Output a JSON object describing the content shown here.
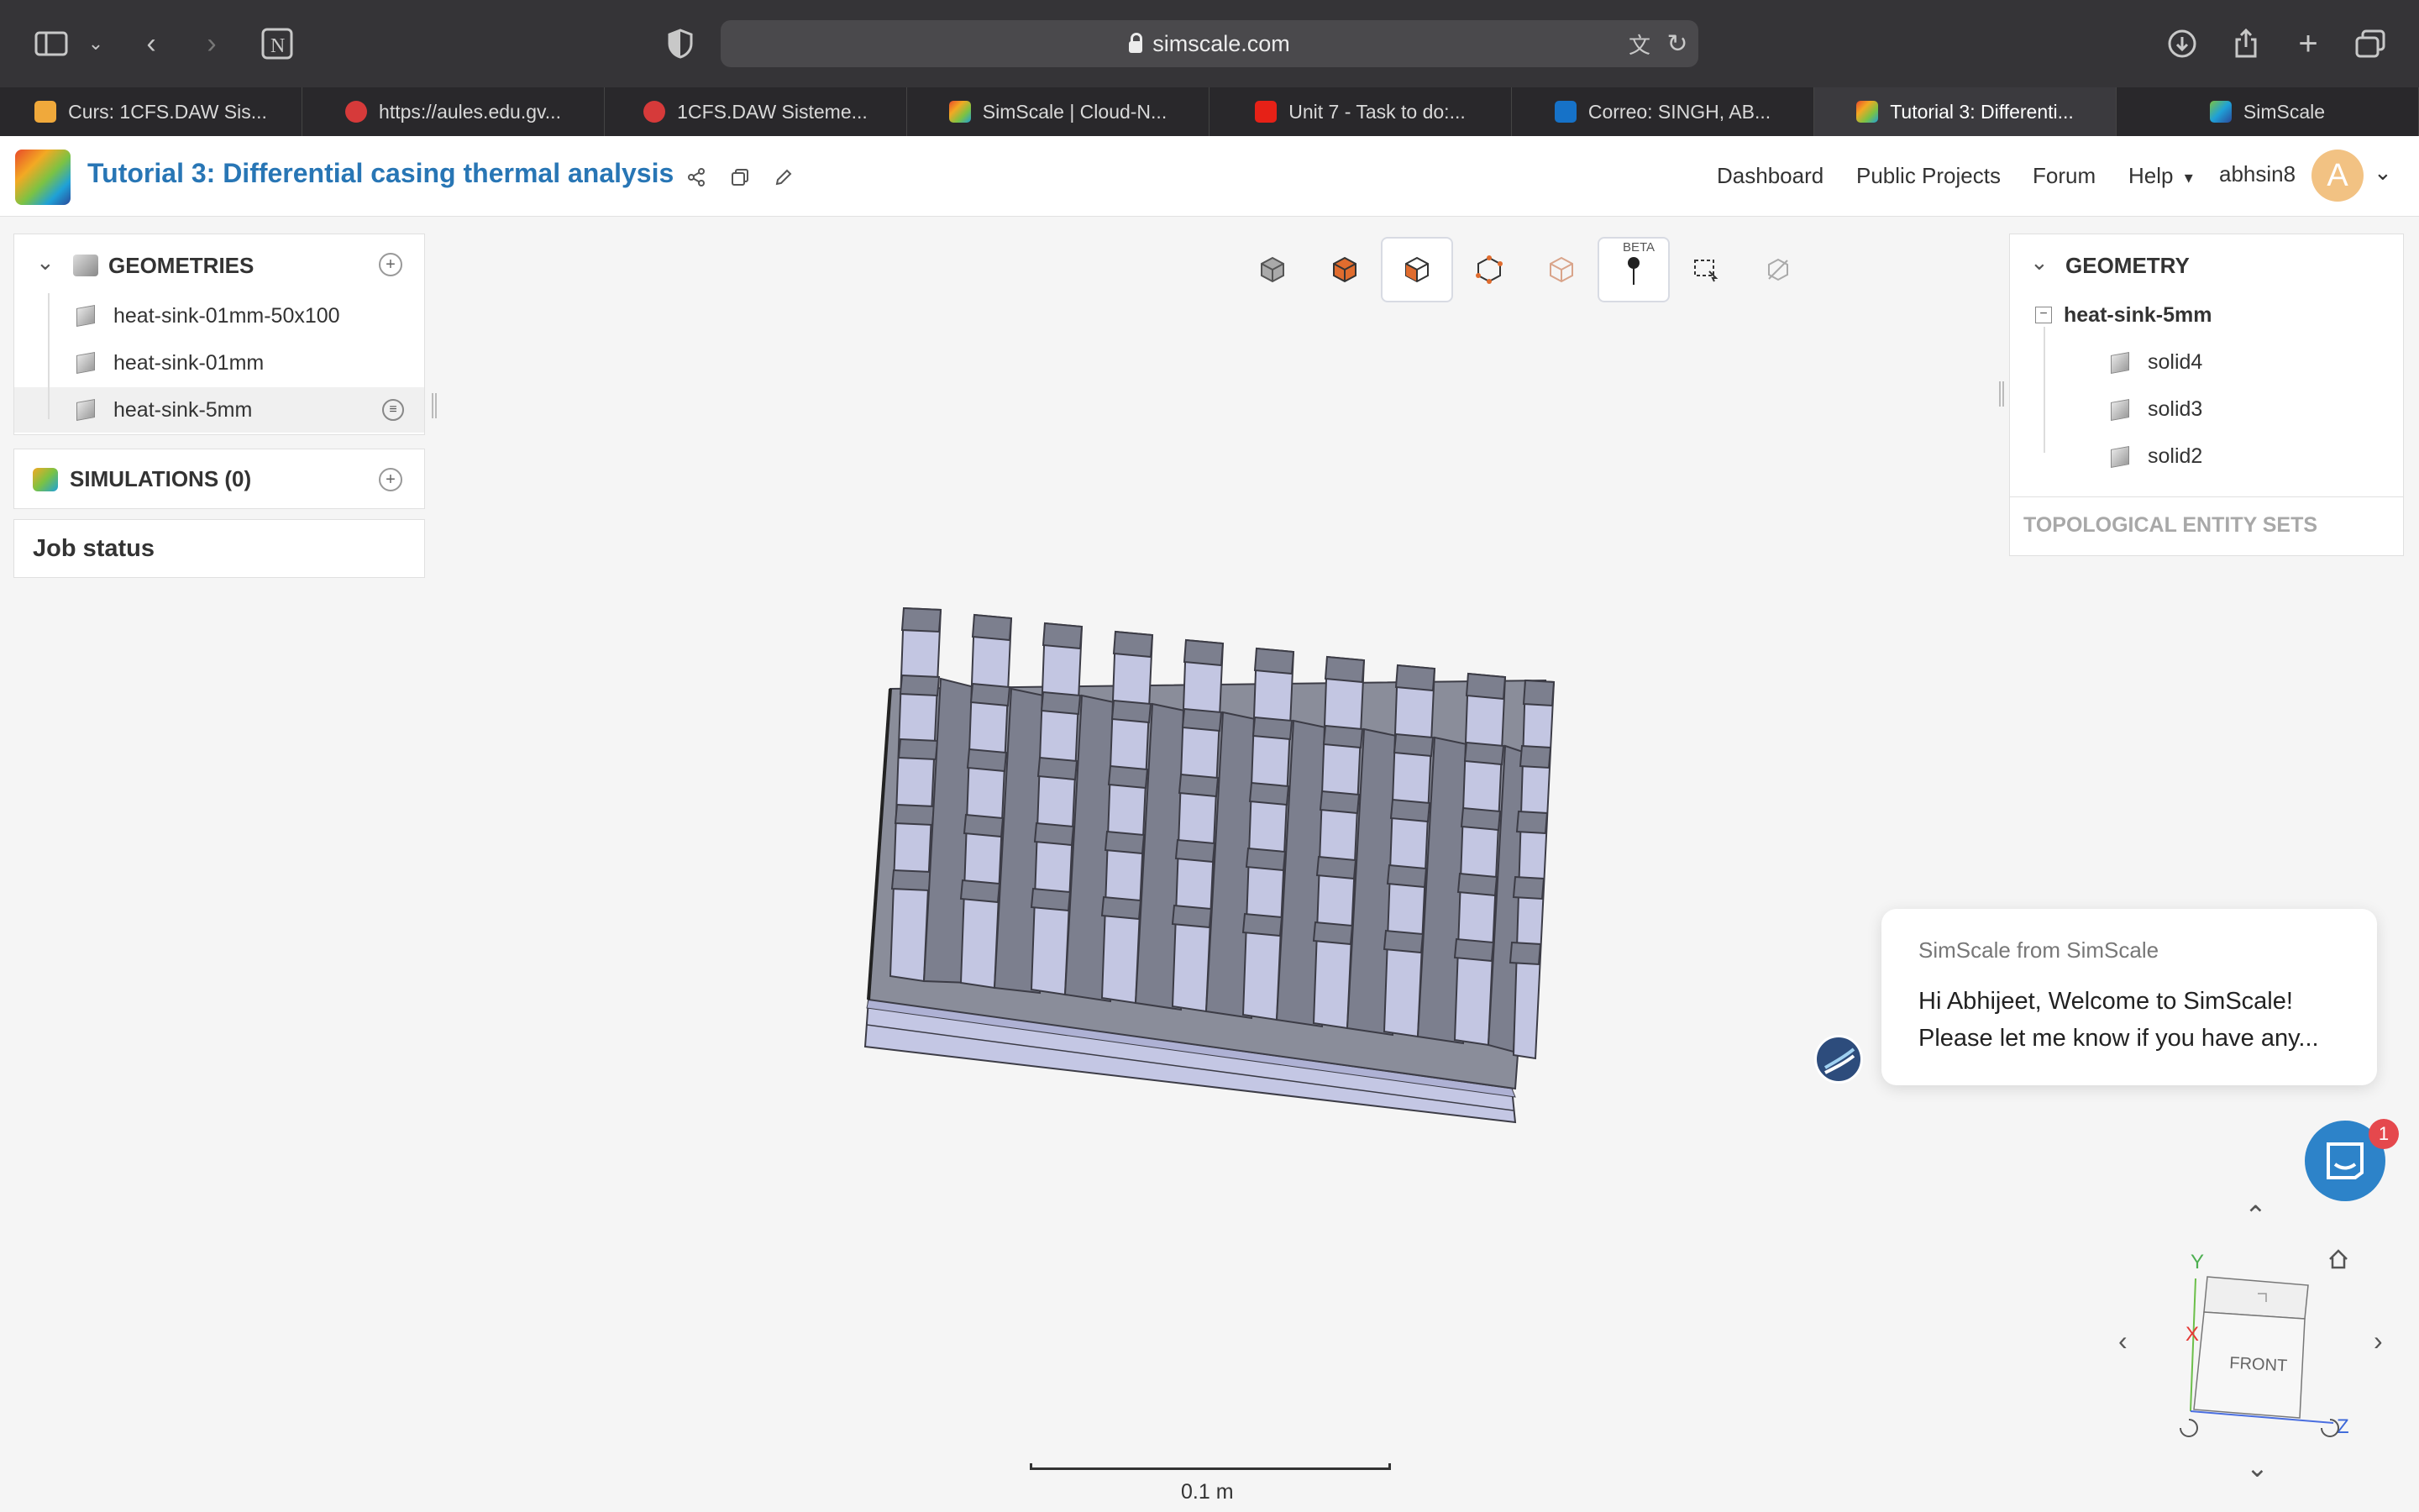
{
  "browser": {
    "url": "simscale.com",
    "tabs": [
      {
        "label": "Curs: 1CFS.DAW Sis...",
        "icon": "moodle-icon",
        "color": "#f0a93b"
      },
      {
        "label": "https://aules.edu.gv...",
        "icon": "gva-icon",
        "color": "#d63a3a"
      },
      {
        "label": "1CFS.DAW Sisteme...",
        "icon": "gva-icon",
        "color": "#d63a3a"
      },
      {
        "label": "SimScale | Cloud-N...",
        "icon": "simscale-icon",
        "color": "#6fb64a"
      },
      {
        "label": "Unit 7 - Task to do:...",
        "icon": "youtube-icon",
        "color": "#e62117"
      },
      {
        "label": "Correo: SINGH, AB...",
        "icon": "outlook-icon",
        "color": "#1672c8"
      },
      {
        "label": "Tutorial 3: Differenti...",
        "icon": "simscale-icon",
        "color": "#6fb64a"
      },
      {
        "label": "SimScale",
        "icon": "simscale-icon",
        "color": "#2b6cb0"
      }
    ]
  },
  "header": {
    "project_title": "Tutorial 3: Differential casing thermal analysis",
    "nav": {
      "dashboard": "Dashboard",
      "public_projects": "Public Projects",
      "forum": "Forum",
      "help": "Help"
    },
    "username": "abhsin8",
    "avatar_letter": "A"
  },
  "left_panel": {
    "geometries_title": "GEOMETRIES",
    "geometries": [
      {
        "label": "heat-sink-01mm-50x100"
      },
      {
        "label": "heat-sink-01mm"
      },
      {
        "label": "heat-sink-5mm"
      }
    ],
    "simulations_title": "SIMULATIONS (0)",
    "job_status_title": "Job status"
  },
  "toolbar": {
    "beta_label": "BETA"
  },
  "right_panel": {
    "title": "GEOMETRY",
    "root": "heat-sink-5mm",
    "children": [
      "solid4",
      "solid3",
      "solid2"
    ],
    "topological_title": "TOPOLOGICAL ENTITY SETS"
  },
  "chat": {
    "from": "SimScale from SimScale",
    "line1": "Hi Abhijeet, Welcome to SimScale!",
    "line2": "Please let me know if you have any...",
    "badge": "1"
  },
  "viewer": {
    "scale_label": "0.1 m",
    "cube_face": "FRONT",
    "axes": {
      "x": "X",
      "y": "Y",
      "z": "Z"
    }
  },
  "colors": {
    "accent_blue": "#2876b5",
    "fin_light": "#c3c6e2",
    "fin_dark": "#7c7f8e"
  }
}
